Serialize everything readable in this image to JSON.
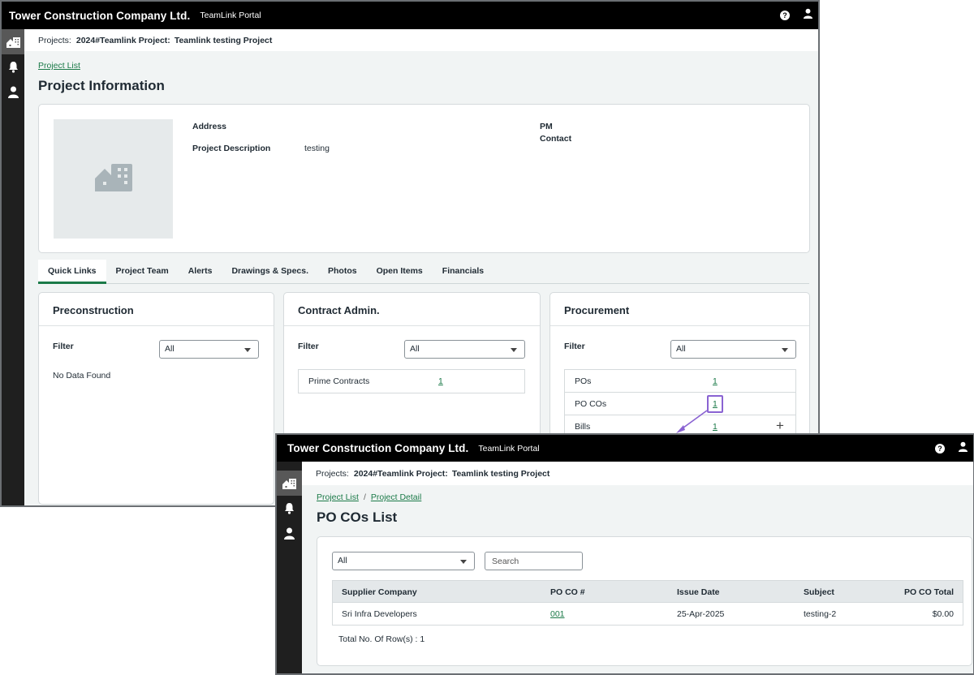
{
  "app": {
    "company": "Tower Construction Company Ltd.",
    "portal": "TeamLink Portal",
    "help_glyph": "?"
  },
  "project_info_window": {
    "breadcrumb": {
      "label": "Projects:",
      "code": "2024#Teamlink Project:",
      "name": "Teamlink testing Project"
    },
    "back_link": "Project List",
    "page_title": "Project Information",
    "details": {
      "address_label": "Address",
      "description_label": "Project Description",
      "description_value": "testing",
      "pm_label": "PM",
      "contact_label": "Contact"
    },
    "tabs": [
      {
        "label": "Quick Links",
        "active": true
      },
      {
        "label": "Project Team"
      },
      {
        "label": "Alerts"
      },
      {
        "label": "Drawings & Specs."
      },
      {
        "label": "Photos"
      },
      {
        "label": "Open Items"
      },
      {
        "label": "Financials"
      }
    ],
    "panels": {
      "preconstruction": {
        "title": "Preconstruction",
        "filter_label": "Filter",
        "filter_value": "All",
        "empty_text": "No Data Found"
      },
      "contract_admin": {
        "title": "Contract Admin.",
        "filter_label": "Filter",
        "filter_value": "All",
        "rows": [
          {
            "name": "Prime Contracts",
            "count": "1"
          }
        ]
      },
      "procurement": {
        "title": "Procurement",
        "filter_label": "Filter",
        "filter_value": "All",
        "rows": [
          {
            "name": "POs",
            "count": "1"
          },
          {
            "name": "PO COs",
            "count": "1"
          },
          {
            "name": "Bills",
            "count": "1",
            "add_glyph": "+"
          }
        ]
      }
    }
  },
  "po_cos_window": {
    "breadcrumb": {
      "label": "Projects:",
      "code": "2024#Teamlink Project:",
      "name": "Teamlink testing Project"
    },
    "nav": {
      "project_list": "Project List",
      "separator": "/",
      "project_detail": "Project Detail"
    },
    "page_title": "PO COs List",
    "filter_value": "All",
    "search_placeholder": "Search",
    "columns": [
      "Supplier Company",
      "PO CO #",
      "Issue Date",
      "Subject",
      "PO CO Total"
    ],
    "rows": [
      {
        "supplier": "Sri Infra Developers",
        "po_co_number": "001",
        "issue_date": "25-Apr-2025",
        "subject": "testing-2",
        "total": "$0.00"
      }
    ],
    "row_count_text": "Total No. Of Row(s) : 1"
  },
  "colors": {
    "accent_green": "#1b7a48",
    "highlight_purple": "#8a63d2",
    "topbar": "#000000",
    "rail": "#1f1f1f"
  }
}
